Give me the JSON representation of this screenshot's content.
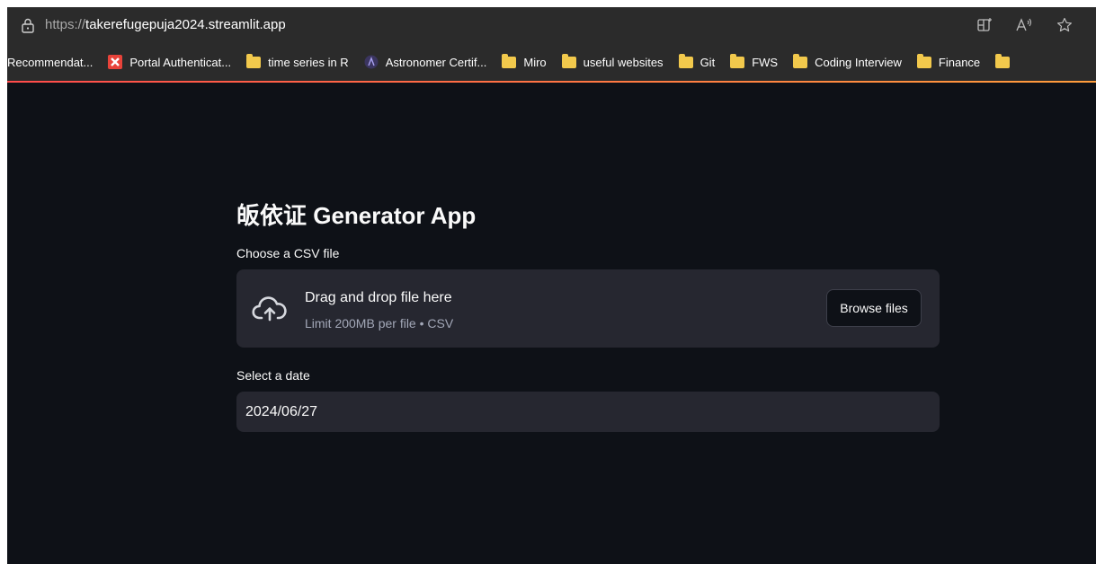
{
  "browser": {
    "url_protocol": "https://",
    "url_host": "takerefugepuja2024.streamlit.app",
    "icons": [
      "lock-icon",
      "split-screen-icon",
      "read-aloud-icon",
      "favorite-star-icon"
    ],
    "bookmarks": [
      {
        "label": "Recommendat...",
        "icon": "none"
      },
      {
        "label": "Portal Authenticat...",
        "icon": "red-x-logo"
      },
      {
        "label": "time series in R",
        "icon": "folder-icon"
      },
      {
        "label": "Astronomer Certif...",
        "icon": "astronomer-logo"
      },
      {
        "label": "Miro",
        "icon": "folder-icon"
      },
      {
        "label": "useful websites",
        "icon": "folder-icon"
      },
      {
        "label": "Git",
        "icon": "folder-icon"
      },
      {
        "label": "FWS",
        "icon": "folder-icon"
      },
      {
        "label": "Coding Interview",
        "icon": "folder-icon"
      },
      {
        "label": "Finance",
        "icon": "folder-icon"
      }
    ]
  },
  "app": {
    "title": "皈依证 Generator App",
    "uploader": {
      "label": "Choose a CSV file",
      "drop_text": "Drag and drop file here",
      "limit_text": "Limit 200MB per file • CSV",
      "button_label": "Browse files",
      "icon": "cloud-upload-icon"
    },
    "date": {
      "label": "Select a date",
      "value": "2024/06/27"
    }
  },
  "colors": {
    "background": "#0e1117",
    "panel": "#262730",
    "text": "#fafafa",
    "muted_text": "#a3a8b8",
    "browser_chrome": "#2b2b2b",
    "folder": "#f2c94c",
    "accent": "#ff4b4b"
  }
}
